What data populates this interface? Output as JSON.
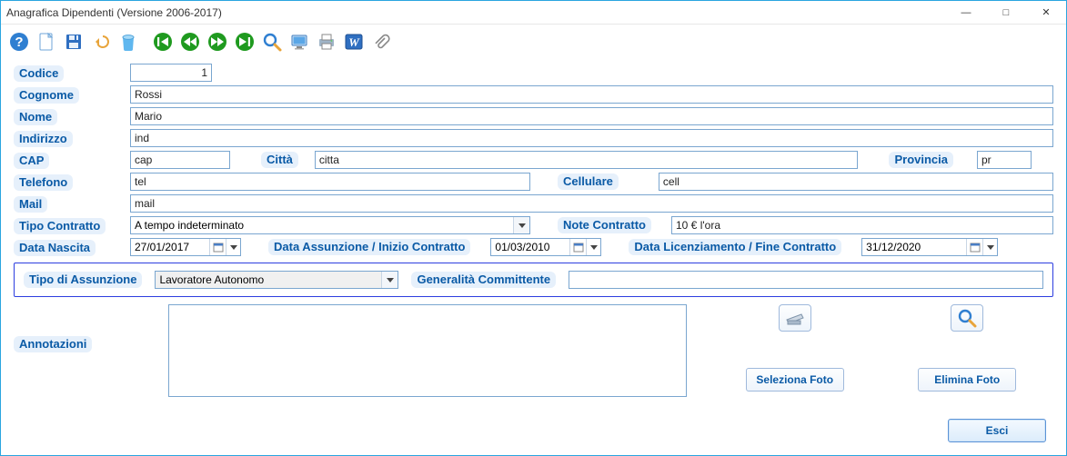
{
  "window": {
    "title": "Anagrafica Dipendenti (Versione 2006-2017)"
  },
  "labels": {
    "codice": "Codice",
    "cognome": "Cognome",
    "nome": "Nome",
    "indirizzo": "Indirizzo",
    "cap": "CAP",
    "citta": "Città",
    "provincia": "Provincia",
    "telefono": "Telefono",
    "cellulare": "Cellulare",
    "mail": "Mail",
    "tipo_contratto": "Tipo Contratto",
    "note_contratto": "Note Contratto",
    "data_nascita": "Data Nascita",
    "data_assunzione": "Data Assunzione / Inizio Contratto",
    "data_licenziamento": "Data Licenziamento / Fine Contratto",
    "tipo_assunzione": "Tipo di Assunzione",
    "generalita_committente": "Generalità Committente",
    "annotazioni": "Annotazioni",
    "seleziona_foto": "Seleziona Foto",
    "elimina_foto": "Elimina Foto",
    "esci": "Esci"
  },
  "fields": {
    "codice": "1",
    "cognome": "Rossi",
    "nome": "Mario",
    "indirizzo": "ind",
    "cap": "cap",
    "citta": "citta",
    "provincia": "pr",
    "telefono": "tel",
    "cellulare": "cell",
    "mail": "mail",
    "tipo_contratto": "A tempo indeterminato",
    "note_contratto": "10 € l'ora",
    "data_nascita": "27/01/2017",
    "data_assunzione": "01/03/2010",
    "data_licenziamento": "31/12/2020",
    "tipo_assunzione": "Lavoratore Autonomo",
    "generalita_committente": "",
    "annotazioni": ""
  },
  "toolbar_icons": [
    "help-icon",
    "new-icon",
    "save-icon",
    "undo-icon",
    "delete-icon",
    "first-icon",
    "prev-icon",
    "next-icon",
    "last-icon",
    "search-icon",
    "monitor-icon",
    "print-icon",
    "word-icon",
    "attach-icon"
  ]
}
